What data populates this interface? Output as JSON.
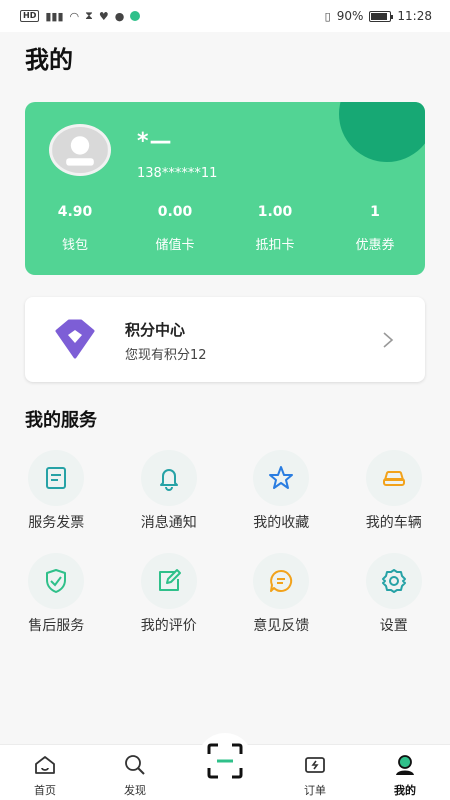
{
  "status_bar": {
    "left_label": "HD",
    "battery": "90%",
    "time": "11:28"
  },
  "page": {
    "title": "我的"
  },
  "profile": {
    "name": "*—",
    "phone": "138******11"
  },
  "stats": [
    {
      "value": "4.90",
      "label": "钱包"
    },
    {
      "value": "0.00",
      "label": "储值卡"
    },
    {
      "value": "1.00",
      "label": "抵扣卡"
    },
    {
      "value": "1",
      "label": "优惠券"
    }
  ],
  "points": {
    "title": "积分中心",
    "subtitle": "您现有积分12"
  },
  "services": {
    "title": "我的服务",
    "items": [
      {
        "label": "服务发票",
        "icon": "invoice-icon"
      },
      {
        "label": "消息通知",
        "icon": "bell-icon"
      },
      {
        "label": "我的收藏",
        "icon": "star-icon"
      },
      {
        "label": "我的车辆",
        "icon": "car-icon"
      },
      {
        "label": "售后服务",
        "icon": "shield-check-icon"
      },
      {
        "label": "我的评价",
        "icon": "edit-icon"
      },
      {
        "label": "意见反馈",
        "icon": "chat-icon"
      },
      {
        "label": "设置",
        "icon": "gear-icon"
      }
    ]
  },
  "tabbar": {
    "items": [
      {
        "label": "首页",
        "icon": "home-icon"
      },
      {
        "label": "发现",
        "icon": "search-icon"
      },
      {
        "label": "",
        "icon": "scan-icon"
      },
      {
        "label": "订单",
        "icon": "order-icon"
      },
      {
        "label": "我的",
        "icon": "profile-icon",
        "active": true
      }
    ]
  },
  "colors": {
    "brand": "#52d494",
    "brand_dark": "#17a874",
    "points_purple": "#7d5ed6",
    "icon_teal": "#26a2a6",
    "icon_blue": "#2a7de1",
    "icon_orange": "#f2a21b",
    "icon_green": "#2fc08a"
  }
}
